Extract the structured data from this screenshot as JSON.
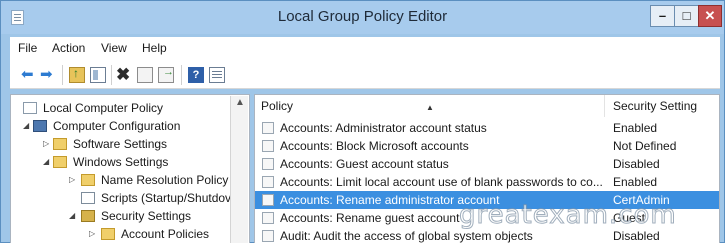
{
  "window": {
    "title": "Local Group Policy Editor",
    "minimize_label": "–",
    "maximize_label": "□",
    "close_label": "✕"
  },
  "menu": [
    "File",
    "Action",
    "View",
    "Help"
  ],
  "toolbar": {
    "icons": [
      "back-icon",
      "forward-icon",
      "up-one-level-icon",
      "show-hide-tree-icon",
      "delete-icon",
      "properties-icon",
      "export-list-icon",
      "help-icon",
      "view-icon"
    ],
    "back_glyph": "⬅",
    "forward_glyph": "➡",
    "delete_glyph": "✖",
    "help_glyph": "?"
  },
  "tree": {
    "scroll_up_glyph": "▲",
    "nodes": [
      {
        "label": "Local Computer Policy",
        "icon": "policy-icon",
        "expander": ""
      },
      {
        "label": "Computer Configuration",
        "icon": "computer-icon",
        "expander": "◢"
      },
      {
        "label": "Software Settings",
        "icon": "folder-icon",
        "expander": "▷"
      },
      {
        "label": "Windows Settings",
        "icon": "folder-icon",
        "expander": "◢"
      },
      {
        "label": "Name Resolution Policy",
        "icon": "folder-icon",
        "expander": "▷"
      },
      {
        "label": "Scripts (Startup/Shutdov",
        "icon": "script-icon",
        "expander": ""
      },
      {
        "label": "Security Settings",
        "icon": "security-icon",
        "expander": "◢"
      },
      {
        "label": "Account Policies",
        "icon": "folder-icon",
        "expander": "▷"
      }
    ]
  },
  "list": {
    "columns": {
      "policy": "Policy",
      "setting": "Security Setting"
    },
    "sort_glyph": "▲",
    "rows": [
      {
        "policy": "Accounts: Administrator account status",
        "setting": "Enabled"
      },
      {
        "policy": "Accounts: Block Microsoft accounts",
        "setting": "Not Defined"
      },
      {
        "policy": "Accounts: Guest account status",
        "setting": "Disabled"
      },
      {
        "policy": "Accounts: Limit local account use of blank passwords to co...",
        "setting": "Enabled"
      },
      {
        "policy": "Accounts: Rename administrator account",
        "setting": "CertAdmin",
        "selected": true
      },
      {
        "policy": "Accounts: Rename guest account",
        "setting": "Guest"
      },
      {
        "policy": "Audit: Audit the access of global system objects",
        "setting": "Disabled"
      }
    ]
  },
  "watermark": "greatexam.com",
  "colors": {
    "title_bar": "#a7cbed",
    "selection": "#3b8fe0",
    "close_button": "#c75050"
  }
}
